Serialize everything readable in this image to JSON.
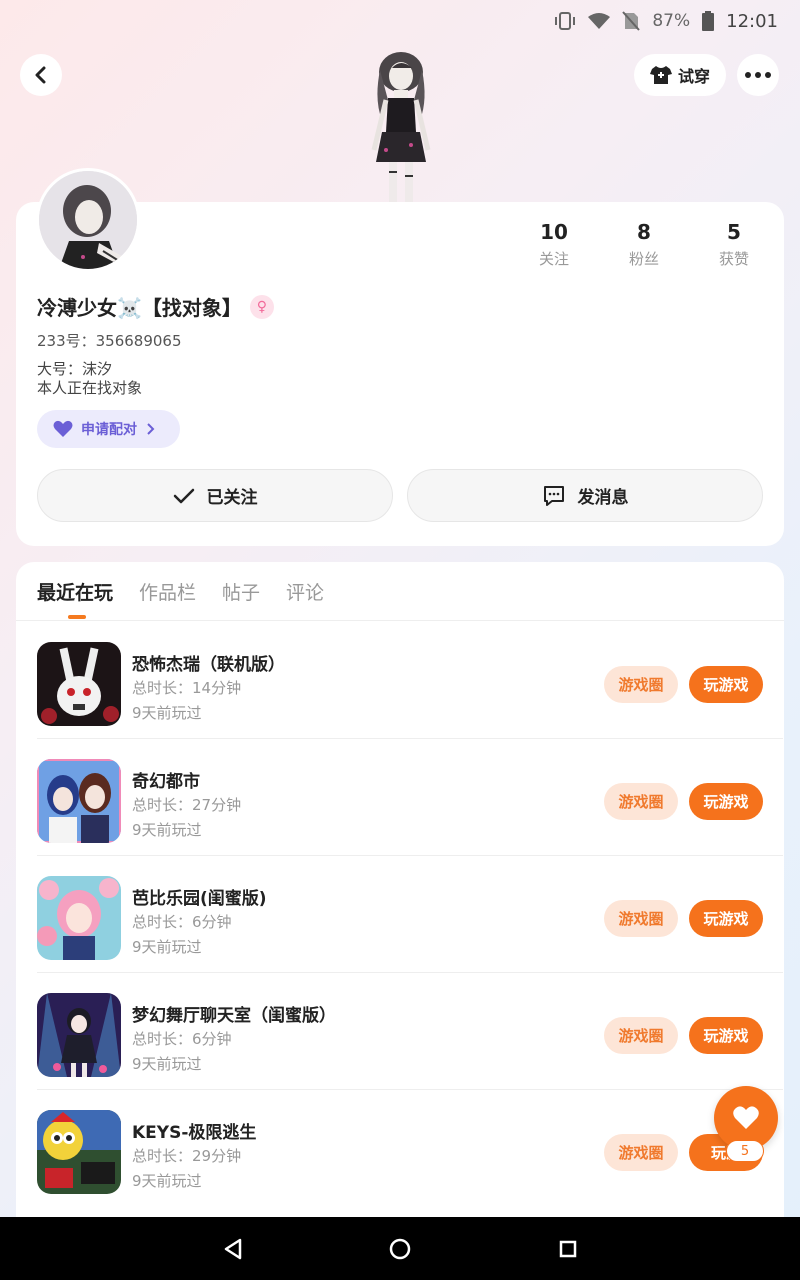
{
  "status_bar": {
    "battery": "87%",
    "time": "12:01"
  },
  "header": {
    "tryon_label": "试穿"
  },
  "profile": {
    "nickname": "冷溥少女☠️【找对象】",
    "uid": "233号：356689065",
    "bio_line1": "大号：沫汐",
    "bio_line2": "本人正在找对象",
    "pair_label": "申请配对",
    "stats": [
      {
        "value": "10",
        "label": "关注"
      },
      {
        "value": "8",
        "label": "粉丝"
      },
      {
        "value": "5",
        "label": "获赞"
      }
    ],
    "follow_label": "已关注",
    "message_label": "发消息"
  },
  "tabs": [
    "最近在玩",
    "作品栏",
    "帖子",
    "评论"
  ],
  "games": [
    {
      "title": "恐怖杰瑞（联机版）",
      "duration": "总时长：14分钟",
      "last_played": "9天前玩过",
      "circle_label": "游戏圈",
      "play_label": "玩游戏",
      "icon_color": "#3a1a1c"
    },
    {
      "title": "奇幻都市",
      "duration": "总时长：27分钟",
      "last_played": "9天前玩过",
      "circle_label": "游戏圈",
      "play_label": "玩游戏",
      "icon_color": "#5a8ed8"
    },
    {
      "title": "芭比乐园(闺蜜版)",
      "duration": "总时长：6分钟",
      "last_played": "9天前玩过",
      "circle_label": "游戏圈",
      "play_label": "玩游戏",
      "icon_color": "#f0a6c4"
    },
    {
      "title": "梦幻舞厅聊天室（闺蜜版）",
      "duration": "总时长：6分钟",
      "last_played": "9天前玩过",
      "circle_label": "游戏圈",
      "play_label": "玩游戏",
      "icon_color": "#3b2a6e"
    },
    {
      "title": "KEYS-极限逃生",
      "duration": "总时长：29分钟",
      "last_played": "9天前玩过",
      "circle_label": "游戏圈",
      "play_label": "玩游",
      "icon_color": "#2a6f3a"
    }
  ],
  "fab": {
    "count": "5"
  }
}
